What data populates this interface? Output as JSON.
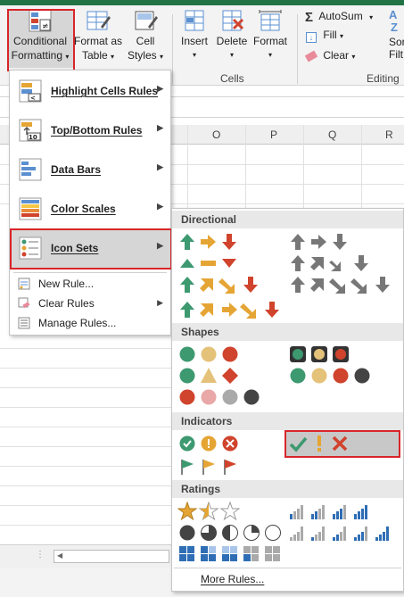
{
  "ribbon": {
    "conditional_formatting": {
      "line1": "Conditional",
      "line2": "Formatting"
    },
    "format_as_table": {
      "line1": "Format as",
      "line2": "Table"
    },
    "cell_styles": {
      "line1": "Cell",
      "line2": "Styles"
    },
    "insert": "Insert",
    "delete": "Delete",
    "format": "Format",
    "cells_group": "Cells",
    "autosum": "AutoSum",
    "fill": "Fill",
    "clear": "Clear",
    "editing_group": "Editing",
    "sort_partial": "Sor",
    "filter_partial": "Filt",
    "az_partial": "A"
  },
  "columns": [
    "O",
    "P",
    "Q",
    "R"
  ],
  "menu": {
    "items": [
      {
        "label": "Highlight Cells Rules",
        "icon": "highlight-cells-icon"
      },
      {
        "label": "Top/Bottom Rules",
        "icon": "top-bottom-icon"
      },
      {
        "label": "Data Bars",
        "icon": "data-bars-icon"
      },
      {
        "label": "Color Scales",
        "icon": "color-scales-icon"
      },
      {
        "label": "Icon Sets",
        "icon": "icon-sets-icon"
      }
    ],
    "new_rule": "New Rule...",
    "clear_rules": "Clear Rules",
    "manage_rules": "Manage Rules..."
  },
  "submenu": {
    "sections": [
      "Directional",
      "Shapes",
      "Indicators",
      "Ratings"
    ],
    "more_rules": "More Rules..."
  },
  "colors": {
    "green": "#3d9970",
    "yellow": "#e5a534",
    "red": "#d0432c",
    "gray": "#777777",
    "accent": "#217346",
    "highlight_box": "#d9252a"
  }
}
